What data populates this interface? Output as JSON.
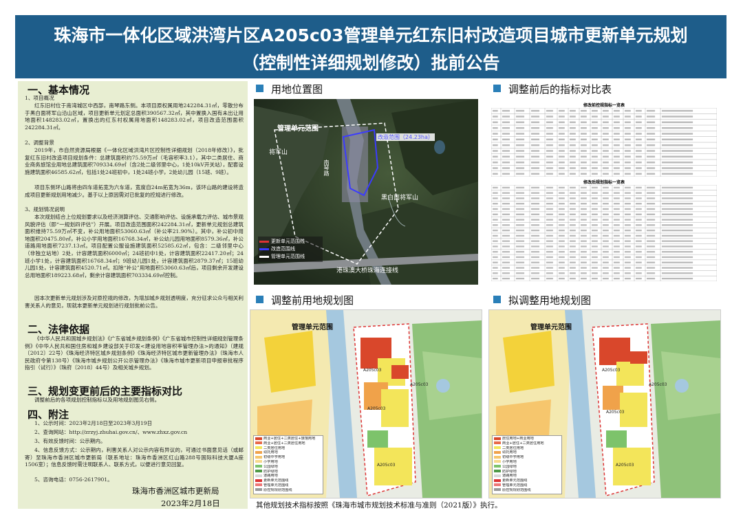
{
  "header": {
    "title_line1": "珠海市一体化区域洪湾片区A205c03管理单元红东旧村改造项目城市更新单元规划",
    "title_line2": "（控制性详细规划修改）批前公告"
  },
  "left": {
    "s1": "一、基本情况",
    "s1_p1": "1、项目概况",
    "s1_p2": "红东旧村位于南湾城区中西部，南琴路东侧。本项目原权属用地242284.31㎡，零散分布于黑白面将军山沿山区域，项目更新单元划定总面积390567.32㎡，其中置换入国有未出让用地面积148283.02㎡，置换出的红东村权属用地面积148283.02㎡，项目改造范围面积242284.31㎡。",
    "s1_p3": "2、调整背景",
    "s1_p4": "2019年，市自然资源局根据《一体化区域洪湾片区控制性详细规划（2018年修改）》，批复红东旧村改造项目规划条件：总建筑面积约75.59万㎡（毛容积率3.1），其中二类居住、商业商务旅馆业用地总建筑面积709334.69㎡（含2处二级邻里中心，1处10kV开关站），配套设施建筑面积46585.62㎡，包括1处24班初中，1处24班小学，2处幼儿园（15班、9班）。",
    "s1_p5": "项目东侧环山路将由四车道拓宽为六车道，宽度自24m拓宽为36m，该环山路的建设将造成项目更新规划用地减少。基于以上原因需对已批复的控规进行修改。",
    "s1_p6": "3、规划情况说明",
    "s1_p7": "本次规划结合上位规划要求以及经济测算评估、交通影响评估、设施承载力评估、城市景观风貌评估（即“一规划四评估”）开展。项目改造范围面积242284.31㎡，更新单元规划总建筑面积维持75.59万㎡不变，补公用地面积53060.63㎡（补公率21.90%）。其中，补公初中用地面积20475.80㎡，补公小学用地面积16768.34㎡，补公幼儿园用地面积8579.36㎡，补公道路用地面积7237.13㎡。项目配置公服设施建筑面积52585.62㎡，包含：二级邻里中心（非独立站地）2处，计容建筑面积6000㎡；24班初中1处，计容建筑面积22417.20㎡；24班小学1处，计容建筑面积16768.34㎡；9班幼儿园1处，计容建筑面积2879.37㎡；15班幼儿园1处，计容建筑面积4520.71㎡。扣除“补公”用地面积53060.63㎡后，项目剩余开发建设总用地面积189223.68㎡，剩余计容建筑面积703334.69㎡控制。",
    "s1_p8": "因本次更新单元规划涉及对原控规的修改，为增加城乡规划透明度，充分征求公众与相关利害关系人的意见，现就本更新单元规划进行规划批前公告。",
    "s2": "二、法律依据",
    "s2_p1": "《中华人民共和国城乡规划法》《广东省城乡规划条例》《广东省城市控制性详细规划管理条例》《中华人民共和国住房和城乡建设部关于印发<建设用地容积率管理办法>的通知》（建规〔2012〕22号）《珠海经济特区城乡规划条例》《珠海经济特区城市更新管理办法》（珠海市人民政府令第138号）《珠海市城乡规划公开公示管理办法》《珠海市城市更新项目申报审批程序指引（试行）》（珠府〔2018〕44号）及相关城乡规划。",
    "s3": "三、规划变更前后的主要指标对比",
    "s3_p1": "调整前后的各项规划控制指标以及用地规划图见右侧。",
    "s4": "四、附注",
    "s4_items": [
      "1、公示时间：2023年2月18日至2023年3月19日",
      "2、查询网站：http://zrzyj.zhuhai.gov.cn/、www.zhxz.gov.cn",
      "3、有效反馈时间：公示期内。",
      "4、信息反馈方式：公示期内，利害关系人对公示内容有异议的，可通过书面意见话（或邮寄）至珠海市香洲区城市更新局（联系地址：珠海市香洲区红山路288号国际科技大厦A座1506室）；信息反馈时需注明联系人、联系方式，以便进行意见回复。",
      "5、咨询电话：0756-2617901。"
    ],
    "sign_org": "珠海市香洲区城市更新局",
    "sign_date": "2023年2月18日"
  },
  "panels": {
    "location_title": "用地位置图",
    "table_title": "调整前后的指标对比表",
    "before_title": "调整前用地规划图",
    "after_title": "拟调整用地规划图"
  },
  "location_map": {
    "label_boundary": "管理单元范围",
    "label_mountain1": "将军山",
    "label_mountain2": "黑白面将军山",
    "label_road": "南琴路",
    "label_area": "改造范围（24.23ha）",
    "label_highway": "港珠澳大桥珠海连接线",
    "legend": [
      "更新单元范围线",
      "改造范围线",
      "管理单元范围线"
    ]
  },
  "table": {
    "top_title": "修改前控规指标一览表",
    "bottom_title": "修改后规划指标一览表"
  },
  "before_map": {
    "label_boundary": "管理单元范围",
    "codes": [
      "A205c03",
      "A205c03",
      "A205c03",
      "A205c03"
    ],
    "legend": [
      "商业+居住+二类居住+旅馆用地",
      "商业+居住+二类居住用地",
      "二类居住用地",
      "幼托用地",
      "初级中学用地",
      "小学用地",
      "公园绿地",
      "防护绿地",
      "道路用地",
      "更新单元范围线",
      "管理单元范围线",
      "原控规规划范围线"
    ]
  },
  "after_map": {
    "label_boundary": "管理单元范围",
    "codes": [
      "A205c03",
      "A205c03",
      "A205c03",
      "A205c03"
    ],
    "legend": [
      "居住用地+商业用地",
      "商业+居住+二类居住用地",
      "二类居住用地",
      "幼托用地",
      "初级中学用地",
      "小学用地",
      "公园绿地",
      "防护绿地",
      "道路用地",
      "更新单元范围线",
      "管理单元范围线",
      "原控规规划范围线"
    ]
  },
  "footnote": "其他规划技术指标按照《珠海市城市规划技术标准与准则（2021版）》执行。",
  "colors": {
    "header": "#1e5d8a",
    "left_bg": "#e8eed2",
    "accent": "#2a7fb8",
    "residential": "#f3e55a",
    "commercial": "#d9472b",
    "park": "#7dc36b",
    "school": "#f0a24a",
    "road": "#d8d8d8"
  }
}
